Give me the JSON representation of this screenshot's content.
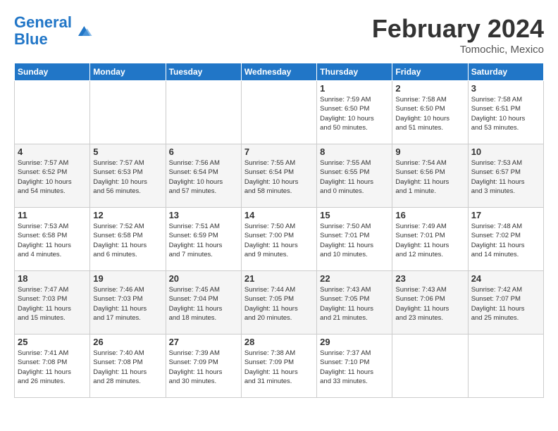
{
  "header": {
    "logo_line1": "General",
    "logo_line2": "Blue",
    "month": "February 2024",
    "location": "Tomochic, Mexico"
  },
  "weekdays": [
    "Sunday",
    "Monday",
    "Tuesday",
    "Wednesday",
    "Thursday",
    "Friday",
    "Saturday"
  ],
  "weeks": [
    [
      {
        "day": "",
        "info": ""
      },
      {
        "day": "",
        "info": ""
      },
      {
        "day": "",
        "info": ""
      },
      {
        "day": "",
        "info": ""
      },
      {
        "day": "1",
        "info": "Sunrise: 7:59 AM\nSunset: 6:50 PM\nDaylight: 10 hours\nand 50 minutes."
      },
      {
        "day": "2",
        "info": "Sunrise: 7:58 AM\nSunset: 6:50 PM\nDaylight: 10 hours\nand 51 minutes."
      },
      {
        "day": "3",
        "info": "Sunrise: 7:58 AM\nSunset: 6:51 PM\nDaylight: 10 hours\nand 53 minutes."
      }
    ],
    [
      {
        "day": "4",
        "info": "Sunrise: 7:57 AM\nSunset: 6:52 PM\nDaylight: 10 hours\nand 54 minutes."
      },
      {
        "day": "5",
        "info": "Sunrise: 7:57 AM\nSunset: 6:53 PM\nDaylight: 10 hours\nand 56 minutes."
      },
      {
        "day": "6",
        "info": "Sunrise: 7:56 AM\nSunset: 6:54 PM\nDaylight: 10 hours\nand 57 minutes."
      },
      {
        "day": "7",
        "info": "Sunrise: 7:55 AM\nSunset: 6:54 PM\nDaylight: 10 hours\nand 58 minutes."
      },
      {
        "day": "8",
        "info": "Sunrise: 7:55 AM\nSunset: 6:55 PM\nDaylight: 11 hours\nand 0 minutes."
      },
      {
        "day": "9",
        "info": "Sunrise: 7:54 AM\nSunset: 6:56 PM\nDaylight: 11 hours\nand 1 minute."
      },
      {
        "day": "10",
        "info": "Sunrise: 7:53 AM\nSunset: 6:57 PM\nDaylight: 11 hours\nand 3 minutes."
      }
    ],
    [
      {
        "day": "11",
        "info": "Sunrise: 7:53 AM\nSunset: 6:58 PM\nDaylight: 11 hours\nand 4 minutes."
      },
      {
        "day": "12",
        "info": "Sunrise: 7:52 AM\nSunset: 6:58 PM\nDaylight: 11 hours\nand 6 minutes."
      },
      {
        "day": "13",
        "info": "Sunrise: 7:51 AM\nSunset: 6:59 PM\nDaylight: 11 hours\nand 7 minutes."
      },
      {
        "day": "14",
        "info": "Sunrise: 7:50 AM\nSunset: 7:00 PM\nDaylight: 11 hours\nand 9 minutes."
      },
      {
        "day": "15",
        "info": "Sunrise: 7:50 AM\nSunset: 7:01 PM\nDaylight: 11 hours\nand 10 minutes."
      },
      {
        "day": "16",
        "info": "Sunrise: 7:49 AM\nSunset: 7:01 PM\nDaylight: 11 hours\nand 12 minutes."
      },
      {
        "day": "17",
        "info": "Sunrise: 7:48 AM\nSunset: 7:02 PM\nDaylight: 11 hours\nand 14 minutes."
      }
    ],
    [
      {
        "day": "18",
        "info": "Sunrise: 7:47 AM\nSunset: 7:03 PM\nDaylight: 11 hours\nand 15 minutes."
      },
      {
        "day": "19",
        "info": "Sunrise: 7:46 AM\nSunset: 7:03 PM\nDaylight: 11 hours\nand 17 minutes."
      },
      {
        "day": "20",
        "info": "Sunrise: 7:45 AM\nSunset: 7:04 PM\nDaylight: 11 hours\nand 18 minutes."
      },
      {
        "day": "21",
        "info": "Sunrise: 7:44 AM\nSunset: 7:05 PM\nDaylight: 11 hours\nand 20 minutes."
      },
      {
        "day": "22",
        "info": "Sunrise: 7:43 AM\nSunset: 7:05 PM\nDaylight: 11 hours\nand 21 minutes."
      },
      {
        "day": "23",
        "info": "Sunrise: 7:43 AM\nSunset: 7:06 PM\nDaylight: 11 hours\nand 23 minutes."
      },
      {
        "day": "24",
        "info": "Sunrise: 7:42 AM\nSunset: 7:07 PM\nDaylight: 11 hours\nand 25 minutes."
      }
    ],
    [
      {
        "day": "25",
        "info": "Sunrise: 7:41 AM\nSunset: 7:08 PM\nDaylight: 11 hours\nand 26 minutes."
      },
      {
        "day": "26",
        "info": "Sunrise: 7:40 AM\nSunset: 7:08 PM\nDaylight: 11 hours\nand 28 minutes."
      },
      {
        "day": "27",
        "info": "Sunrise: 7:39 AM\nSunset: 7:09 PM\nDaylight: 11 hours\nand 30 minutes."
      },
      {
        "day": "28",
        "info": "Sunrise: 7:38 AM\nSunset: 7:09 PM\nDaylight: 11 hours\nand 31 minutes."
      },
      {
        "day": "29",
        "info": "Sunrise: 7:37 AM\nSunset: 7:10 PM\nDaylight: 11 hours\nand 33 minutes."
      },
      {
        "day": "",
        "info": ""
      },
      {
        "day": "",
        "info": ""
      }
    ]
  ]
}
